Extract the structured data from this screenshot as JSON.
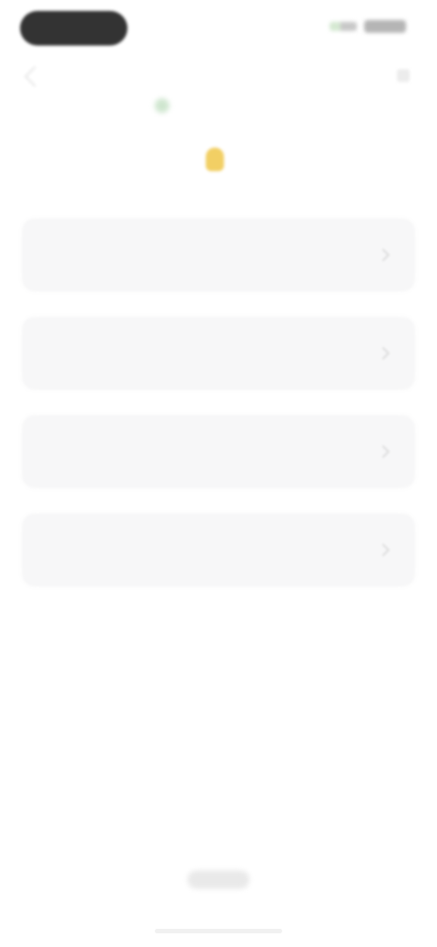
{
  "title": "",
  "options": [
    {
      "label": ""
    },
    {
      "label": ""
    },
    {
      "label": ""
    },
    {
      "label": ""
    }
  ],
  "icons": {
    "back": "chevron-left-icon",
    "more": "more-icon",
    "title": "lightbulb-icon",
    "option_arrow": "chevron-right-icon",
    "battery": "battery-icon",
    "signal": "signal-icon"
  },
  "colors": {
    "background": "#ffffff",
    "card": "#f7f7f8",
    "title": "#333333",
    "accent_yellow": "#f2cf64",
    "accent_green": "#cfe6cf"
  }
}
